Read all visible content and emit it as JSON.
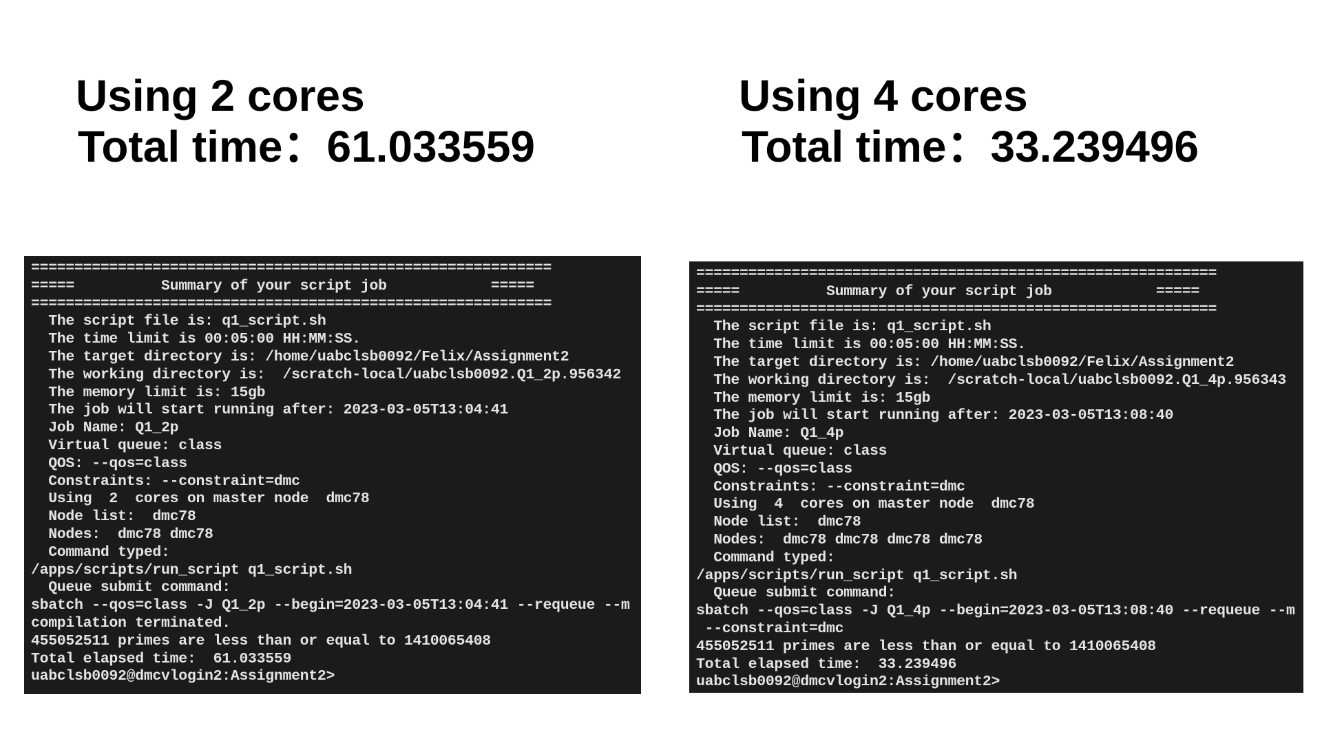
{
  "left": {
    "heading": "Using 2 cores",
    "total_time": "Total time：61.033559",
    "terminal_lines": [
      "============================================================",
      "=====          Summary of your script job            =====",
      "============================================================",
      "  The script file is: q1_script.sh",
      "  The time limit is 00:05:00 HH:MM:SS.",
      "  The target directory is: /home/uabclsb0092/Felix/Assignment2",
      "  The working directory is:  /scratch-local/uabclsb0092.Q1_2p.956342",
      "  The memory limit is: 15gb",
      "  The job will start running after: 2023-03-05T13:04:41",
      "  Job Name: Q1_2p",
      "  Virtual queue: class",
      "  QOS: --qos=class",
      "  Constraints: --constraint=dmc",
      "  Using  2  cores on master node  dmc78",
      "  Node list:  dmc78",
      "  Nodes:  dmc78 dmc78",
      "  Command typed:",
      "/apps/scripts/run_script q1_script.sh",
      "  Queue submit command:",
      "sbatch --qos=class -J Q1_2p --begin=2023-03-05T13:04:41 --requeue --m",
      "compilation terminated.",
      "455052511 primes are less than or equal to 1410065408",
      "Total elapsed time:  61.033559",
      "uabclsb0092@dmcvlogin2:Assignment2>"
    ]
  },
  "right": {
    "heading": "Using 4 cores",
    "total_time": "Total time：33.239496",
    "terminal_lines": [
      "============================================================",
      "=====          Summary of your script job            =====",
      "============================================================",
      "  The script file is: q1_script.sh",
      "  The time limit is 00:05:00 HH:MM:SS.",
      "  The target directory is: /home/uabclsb0092/Felix/Assignment2",
      "  The working directory is:  /scratch-local/uabclsb0092.Q1_4p.956343",
      "  The memory limit is: 15gb",
      "  The job will start running after: 2023-03-05T13:08:40",
      "  Job Name: Q1_4p",
      "  Virtual queue: class",
      "  QOS: --qos=class",
      "  Constraints: --constraint=dmc",
      "  Using  4  cores on master node  dmc78",
      "  Node list:  dmc78",
      "  Nodes:  dmc78 dmc78 dmc78 dmc78",
      "  Command typed:",
      "/apps/scripts/run_script q1_script.sh",
      "  Queue submit command:",
      "sbatch --qos=class -J Q1_4p --begin=2023-03-05T13:08:40 --requeue --m",
      " --constraint=dmc",
      "455052511 primes are less than or equal to 1410065408",
      "Total elapsed time:  33.239496",
      "uabclsb0092@dmcvlogin2:Assignment2>"
    ]
  }
}
